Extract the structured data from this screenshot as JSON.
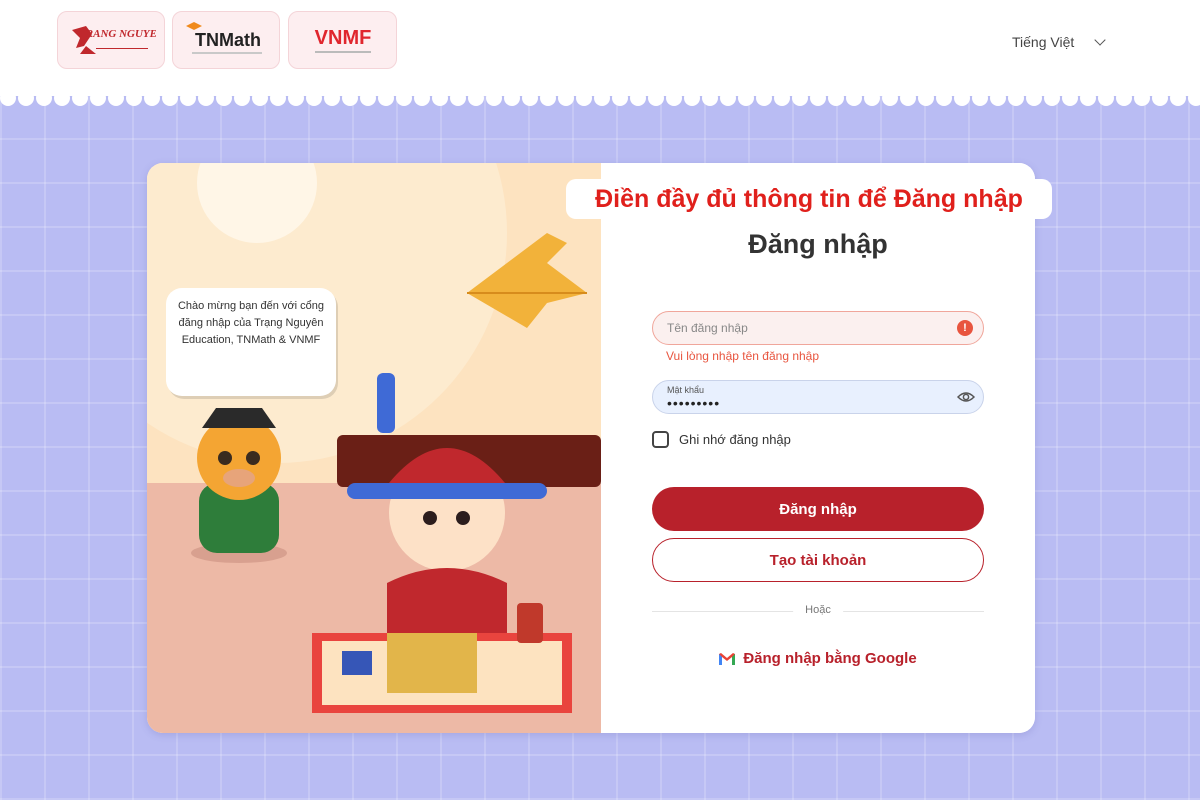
{
  "header": {
    "logos": [
      {
        "name": "trang-nguyen-logo",
        "text": "TRANG NGUYEN"
      },
      {
        "name": "tnmath-logo",
        "text": "TNMath"
      },
      {
        "name": "vnmf-logo",
        "text": "VNMF"
      }
    ],
    "language": "Tiếng Việt"
  },
  "banner": "Điền đầy đủ thông tin để Đăng nhập",
  "illustration": {
    "speech": "Chào mừng bạn đến với cổng đăng nhập của Trạng Nguyên Education, TNMath & VNMF"
  },
  "login": {
    "title": "Đăng nhập",
    "username": {
      "placeholder": "Tên đăng nhập",
      "error": "Vui lòng nhập tên đăng nhập"
    },
    "password": {
      "label": "Mật khẩu",
      "value": "•••••••••"
    },
    "remember_label": "Ghi nhớ đăng nhập",
    "login_button": "Đăng nhập",
    "create_button": "Tạo tài khoản",
    "divider": "Hoặc",
    "google_button": "Đăng nhập bằng Google"
  },
  "colors": {
    "accent": "#b8212b",
    "error": "#e8553f",
    "background": "#b9bcf3"
  }
}
